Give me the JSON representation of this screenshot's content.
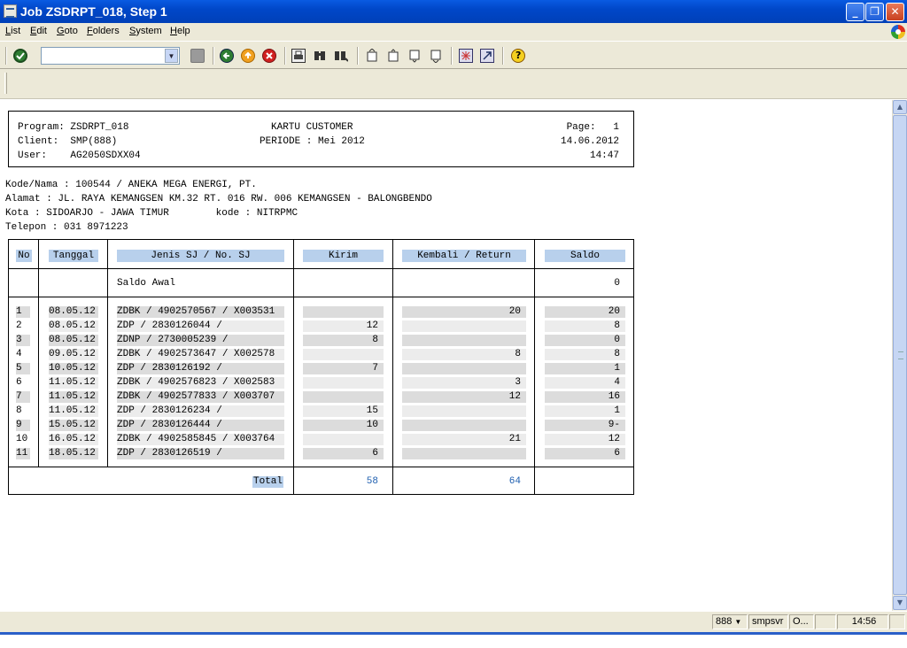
{
  "window": {
    "title": "Job ZSDRPT_018, Step 1"
  },
  "menu": [
    "List",
    "Edit",
    "Goto",
    "Folders",
    "System",
    "Help"
  ],
  "toolbar": {
    "command_value": ""
  },
  "report": {
    "program": "Program: ZSDRPT_018",
    "client": "Client:  SMP(888)",
    "user": "User:    AG2050SDXX04",
    "title": "KARTU CUSTOMER",
    "periode": "PERIODE : Mei 2012",
    "page": "Page:   1",
    "date": "14.06.2012",
    "time": "14:47",
    "kode_nama": "Kode/Nama : 100544 / ANEKA MEGA ENERGI, PT.",
    "alamat": "Alamat : JL. RAYA KEMANGSEN KM.32 RT. 016 RW. 006 KEMANGSEN - BALONGBENDO",
    "kota": "Kota : SIDOARJO - JAWA TIMUR        kode : NITRPMC",
    "telepon": "Telepon : 031 8971223"
  },
  "table": {
    "headers": {
      "no": "No",
      "tanggal": "Tanggal",
      "jenis": "Jenis SJ / No. SJ",
      "kirim": "Kirim",
      "kembali": "Kembali / Return",
      "saldo": "Saldo"
    },
    "saldo_awal": {
      "label": "Saldo Awal",
      "saldo": "0"
    },
    "rows": [
      {
        "no": "1",
        "tanggal": "08.05.12",
        "jenis": "ZDBK / 4902570567 / X003531",
        "kirim": "",
        "kembali": "20",
        "saldo": "20"
      },
      {
        "no": "2",
        "tanggal": "08.05.12",
        "jenis": "ZDP / 2830126044 /",
        "kirim": "12",
        "kembali": "",
        "saldo": "8"
      },
      {
        "no": "3",
        "tanggal": "08.05.12",
        "jenis": "ZDNP / 2730005239 /",
        "kirim": "8",
        "kembali": "",
        "saldo": "0"
      },
      {
        "no": "4",
        "tanggal": "09.05.12",
        "jenis": "ZDBK / 4902573647 / X002578",
        "kirim": "",
        "kembali": "8",
        "saldo": "8"
      },
      {
        "no": "5",
        "tanggal": "10.05.12",
        "jenis": "ZDP / 2830126192 /",
        "kirim": "7",
        "kembali": "",
        "saldo": "1"
      },
      {
        "no": "6",
        "tanggal": "11.05.12",
        "jenis": "ZDBK / 4902576823 / X002583",
        "kirim": "",
        "kembali": "3",
        "saldo": "4"
      },
      {
        "no": "7",
        "tanggal": "11.05.12",
        "jenis": "ZDBK / 4902577833 / X003707",
        "kirim": "",
        "kembali": "12",
        "saldo": "16"
      },
      {
        "no": "8",
        "tanggal": "11.05.12",
        "jenis": "ZDP / 2830126234 /",
        "kirim": "15",
        "kembali": "",
        "saldo": "1"
      },
      {
        "no": "9",
        "tanggal": "15.05.12",
        "jenis": "ZDP / 2830126444 /",
        "kirim": "10",
        "kembali": "",
        "saldo": "9-"
      },
      {
        "no": "10",
        "tanggal": "16.05.12",
        "jenis": "ZDBK / 4902585845 / X003764",
        "kirim": "",
        "kembali": "21",
        "saldo": "12"
      },
      {
        "no": "11",
        "tanggal": "18.05.12",
        "jenis": "ZDP / 2830126519 /",
        "kirim": "6",
        "kembali": "",
        "saldo": "6"
      }
    ],
    "total": {
      "label": "Total",
      "kirim": "58",
      "kembali": "64"
    }
  },
  "status": {
    "client": "888",
    "server": "smpsvr",
    "mode": "O...",
    "time": "14:56"
  }
}
